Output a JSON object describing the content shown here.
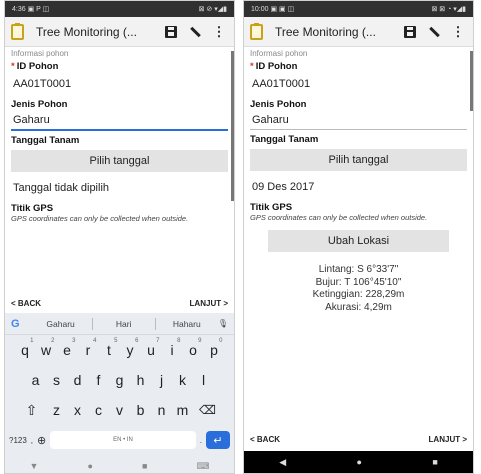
{
  "left": {
    "status": {
      "time": "4:36",
      "left_icons": "▣ P ◫",
      "right_icons": "⊠ ⊘ ▾◢▮"
    },
    "appbar": {
      "title": "Tree Monitoring (...",
      "overflow": "⋮"
    },
    "form": {
      "section": "Informasi pohon",
      "id_label": "ID Pohon",
      "id_value": "AA01T0001",
      "jenis_label": "Jenis Pohon",
      "jenis_value": "Gaharu",
      "tanggal_label": "Tanggal Tanam",
      "tanggal_button": "Pilih tanggal",
      "tanggal_value": "Tanggal tidak dipilih",
      "gps_label": "Titik GPS",
      "gps_hint": "GPS coordinates can only be collected when outside."
    },
    "nav": {
      "back": "< BACK",
      "next": "LANJUT >"
    },
    "keyboard": {
      "suggestions": [
        "Gaharu",
        "Hari",
        "Haharu"
      ],
      "row1": [
        "q",
        "w",
        "e",
        "r",
        "t",
        "y",
        "u",
        "i",
        "o",
        "p"
      ],
      "row1_nums": [
        "1",
        "2",
        "3",
        "4",
        "5",
        "6",
        "7",
        "8",
        "9",
        "0"
      ],
      "row2": [
        "a",
        "s",
        "d",
        "f",
        "g",
        "h",
        "j",
        "k",
        "l"
      ],
      "row3": [
        "z",
        "x",
        "c",
        "v",
        "b",
        "n",
        "m"
      ],
      "shift": "⇧",
      "backspace": "⌫",
      "sym": "?123",
      "comma": ",",
      "globe": "⊕",
      "space": "EN • IN",
      "period": ".",
      "enter": "↵",
      "mic": "🎙"
    },
    "sysnav": {
      "back": "▼",
      "home": "●",
      "recents": "■",
      "kb": "⌨"
    }
  },
  "right": {
    "status": {
      "time": "10:00",
      "left_icons": "▣ ▣ ◫",
      "right_icons": "⊠ ⊠ ◔ ▾◢▮"
    },
    "appbar": {
      "title": "Tree Monitoring (...",
      "overflow": "⋮"
    },
    "form": {
      "section": "Informasi pohon",
      "id_label": "ID Pohon",
      "id_value": "AA01T0001",
      "jenis_label": "Jenis Pohon",
      "jenis_value": "Gaharu",
      "tanggal_label": "Tanggal Tanam",
      "tanggal_button": "Pilih tanggal",
      "tanggal_value": "09 Des 2017",
      "gps_label": "Titik GPS",
      "gps_hint": "GPS coordinates can only be collected when outside.",
      "gps_button": "Ubah Lokasi",
      "lintang": "Lintang: S 6°33'7\"",
      "bujur": "Bujur: T 106°45'10\"",
      "ketinggian": "Ketinggian: 228,29m",
      "akurasi": "Akurasi: 4,29m"
    },
    "nav": {
      "back": "< BACK",
      "next": "LANJUT >"
    },
    "sysnav": {
      "back": "◀",
      "home": "●",
      "recents": "■"
    }
  }
}
